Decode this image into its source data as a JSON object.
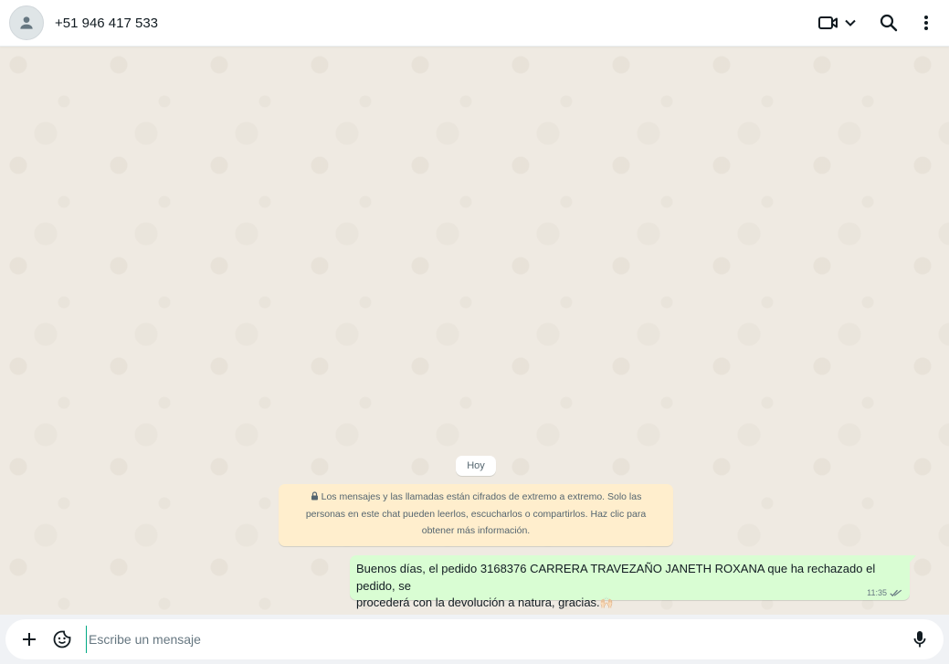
{
  "header": {
    "contact_name": "+51 946 417 533",
    "icons": [
      "avatar-person-icon",
      "video-call-icon",
      "chevron-down-icon",
      "search-icon",
      "menu-dots-icon"
    ]
  },
  "chat": {
    "date_chip": "Hoy",
    "encryption_notice": {
      "line1": "Los mensajes y las llamadas están cifrados de extremo a extremo. Solo las",
      "line2": "personas en este chat pueden leerlos, escucharlos o compartirlos. Haz clic para",
      "line3": "obtener más información."
    },
    "messages": [
      {
        "line1": "Buenos días, el pedido 3168376 CARRERA TRAVEZAÑO JANETH ROXANA que ha rechazado el pedido, se",
        "line2": "procederá con la devolución a natura, gracias.",
        "emoji": "🙌🏻",
        "time": "11:35",
        "status": "read-double-check"
      }
    ]
  },
  "composer": {
    "placeholder": "Escribe un mensaje",
    "value": ""
  },
  "colors": {
    "header_bg": "#ffffff",
    "chat_bg": "#efeae2",
    "outgoing_bubble": "#d9fdd3",
    "notice_bg": "#ffeecd",
    "accent": "#00a884",
    "icon_color": "#54656f"
  }
}
